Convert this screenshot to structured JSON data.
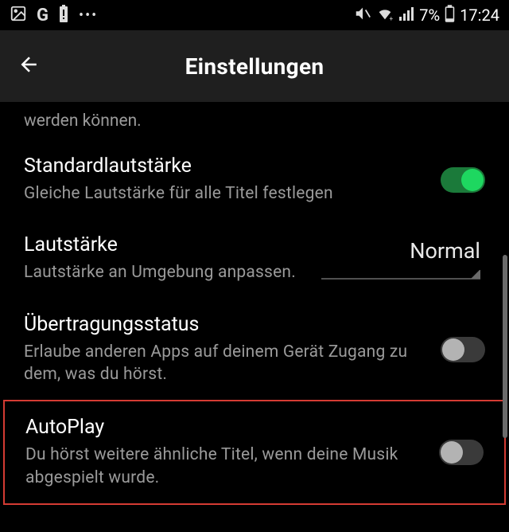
{
  "statusBar": {
    "battery_pct": "7%",
    "time": "17:24"
  },
  "header": {
    "title": "Einstellungen"
  },
  "truncated_prev": "werden können.",
  "settings": {
    "standard_volume": {
      "label": "Standardlautstärke",
      "desc": "Gleiche Lautstärke für alle Titel festlegen",
      "enabled": true
    },
    "volume": {
      "label": "Lautstärke",
      "desc": "Lautstärke an Umgebung anpassen.",
      "value": "Normal"
    },
    "broadcast_status": {
      "label": "Übertragungsstatus",
      "desc": "Erlaube anderen Apps auf deinem Gerät Zugang zu dem, was du hörst.",
      "enabled": false
    },
    "autoplay": {
      "label": "AutoPlay",
      "desc": "Du hörst weitere ähnliche Titel, wenn deine Musik abgespielt wurde.",
      "enabled": false
    }
  }
}
